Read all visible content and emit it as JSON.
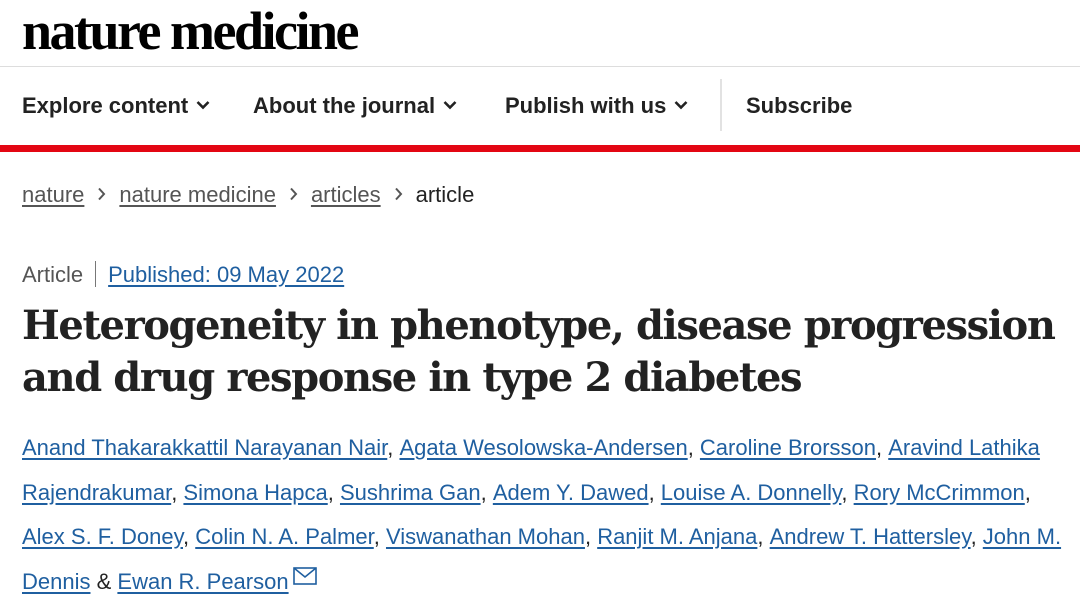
{
  "header": {
    "logo": "nature medicine"
  },
  "nav": {
    "items": [
      {
        "label": "Explore content",
        "icon": "chevron-down-icon"
      },
      {
        "label": "About the journal",
        "icon": "chevron-down-icon"
      },
      {
        "label": "Publish with us",
        "icon": "chevron-down-icon"
      }
    ],
    "subscribe": "Subscribe",
    "accent_color": "#e30613"
  },
  "breadcrumb": {
    "items": [
      "nature",
      "nature medicine",
      "articles"
    ],
    "current": "article",
    "separator_icon": "chevron-right-icon"
  },
  "article": {
    "type": "Article",
    "published": "Published: 09 May 2022",
    "title": "Heterogeneity in phenotype, disease progression and drug response in type 2 diabetes",
    "link_color": "#1f5fa0",
    "authors": [
      "Anand Thakarakkattil Narayanan Nair",
      "Agata Wesolowska-Andersen",
      "Caroline Brorsson",
      "Aravind Lathika Rajendrakumar",
      "Simona Hapca",
      "Sushrima Gan",
      "Adem Y. Dawed",
      "Louise A. Donnelly",
      "Rory McCrimmon",
      "Alex S. F. Doney",
      "Colin N. A. Palmer",
      "Viswanathan Mohan",
      "Ranjit M. Anjana",
      "Andrew T. Hattersley",
      "John M. Dennis",
      "Ewan R. Pearson"
    ],
    "author_separator": ", ",
    "last_author_joiner": " & ",
    "contact_icon": "mail-icon"
  }
}
